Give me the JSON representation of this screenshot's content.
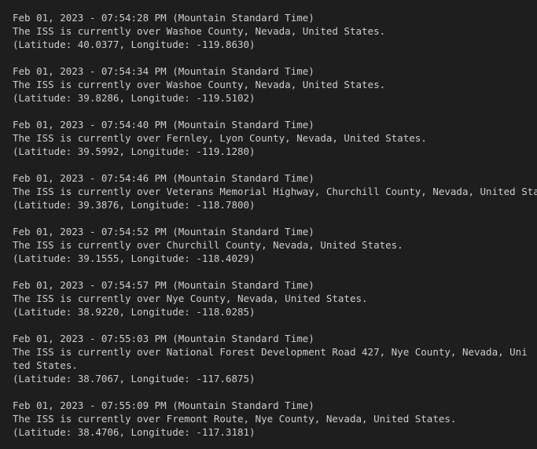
{
  "terminal": {
    "entries": [
      {
        "timestamp": "Feb 01, 2023 - 07:54:28 PM (Mountain Standard Time)",
        "location": "The ISS is currently over Washoe County, Nevada, United States.",
        "coordinates": "(Latitude: 40.0377, Longitude: -119.8630)"
      },
      {
        "timestamp": "Feb 01, 2023 - 07:54:34 PM (Mountain Standard Time)",
        "location": "The ISS is currently over Washoe County, Nevada, United States.",
        "coordinates": "(Latitude: 39.8286, Longitude: -119.5102)"
      },
      {
        "timestamp": "Feb 01, 2023 - 07:54:40 PM (Mountain Standard Time)",
        "location": "The ISS is currently over Fernley, Lyon County, Nevada, United States.",
        "coordinates": "(Latitude: 39.5992, Longitude: -119.1280)"
      },
      {
        "timestamp": "Feb 01, 2023 - 07:54:46 PM (Mountain Standard Time)",
        "location": "The ISS is currently over Veterans Memorial Highway, Churchill County, Nevada, United States.",
        "coordinates": "(Latitude: 39.3876, Longitude: -118.7800)"
      },
      {
        "timestamp": "Feb 01, 2023 - 07:54:52 PM (Mountain Standard Time)",
        "location": "The ISS is currently over Churchill County, Nevada, United States.",
        "coordinates": "(Latitude: 39.1555, Longitude: -118.4029)"
      },
      {
        "timestamp": "Feb 01, 2023 - 07:54:57 PM (Mountain Standard Time)",
        "location": "The ISS is currently over Nye County, Nevada, United States.",
        "coordinates": "(Latitude: 38.9220, Longitude: -118.0285)"
      },
      {
        "timestamp": "Feb 01, 2023 - 07:55:03 PM (Mountain Standard Time)",
        "location": "The ISS is currently over National Forest Development Road 427, Nye County, Nevada, United States.",
        "coordinates": "(Latitude: 38.7067, Longitude: -117.6875)"
      },
      {
        "timestamp": "Feb 01, 2023 - 07:55:09 PM (Mountain Standard Time)",
        "location": "The ISS is currently over Fremont Route, Nye County, Nevada, United States.",
        "coordinates": "(Latitude: 38.4706, Longitude: -117.3181)"
      }
    ]
  }
}
